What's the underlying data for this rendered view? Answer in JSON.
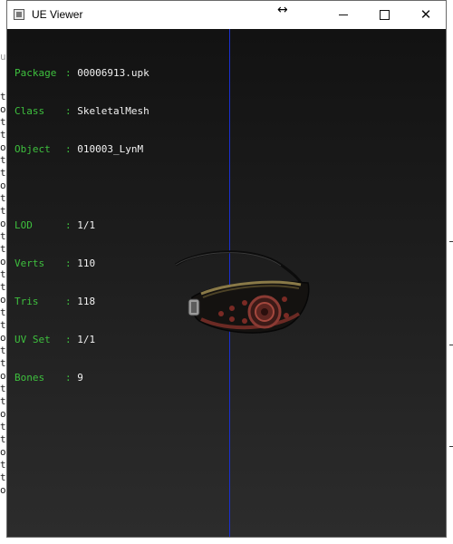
{
  "window": {
    "title": "UE Viewer",
    "resize_cursor": "↔",
    "controls": {
      "minimize": "minimize",
      "maximize": "maximize",
      "close": "✕"
    }
  },
  "info": {
    "rows_top": [
      {
        "key": "Package",
        "value": "00006913.upk"
      },
      {
        "key": "Class",
        "value": "SkeletalMesh"
      },
      {
        "key": "Object",
        "value": "010003_LynM"
      }
    ],
    "rows_stats": [
      {
        "key": "LOD",
        "value": "1/1"
      },
      {
        "key": "Verts",
        "value": "110"
      },
      {
        "key": "Tris",
        "value": "118"
      },
      {
        "key": "UV Set",
        "value": "1/1"
      },
      {
        "key": "Bones",
        "value": "9"
      }
    ],
    "separator": ":"
  },
  "colors": {
    "label": "#3ec03e",
    "value": "#f2f2f2",
    "axis": "#1a2fd0"
  },
  "background_console": {
    "left_letters": [
      "t",
      "o",
      "t",
      "t",
      "o",
      "t",
      "t",
      "o",
      "t",
      "t",
      "o",
      "t",
      "t",
      "o",
      "t",
      "t",
      "o",
      "t",
      "t",
      "o",
      "t",
      "t",
      "o",
      "t",
      "t",
      "o",
      "t",
      "t",
      "o",
      "t",
      "t",
      "o"
    ],
    "top_fragment": "u"
  },
  "mesh": {
    "name": "eyepatch-mesh"
  }
}
